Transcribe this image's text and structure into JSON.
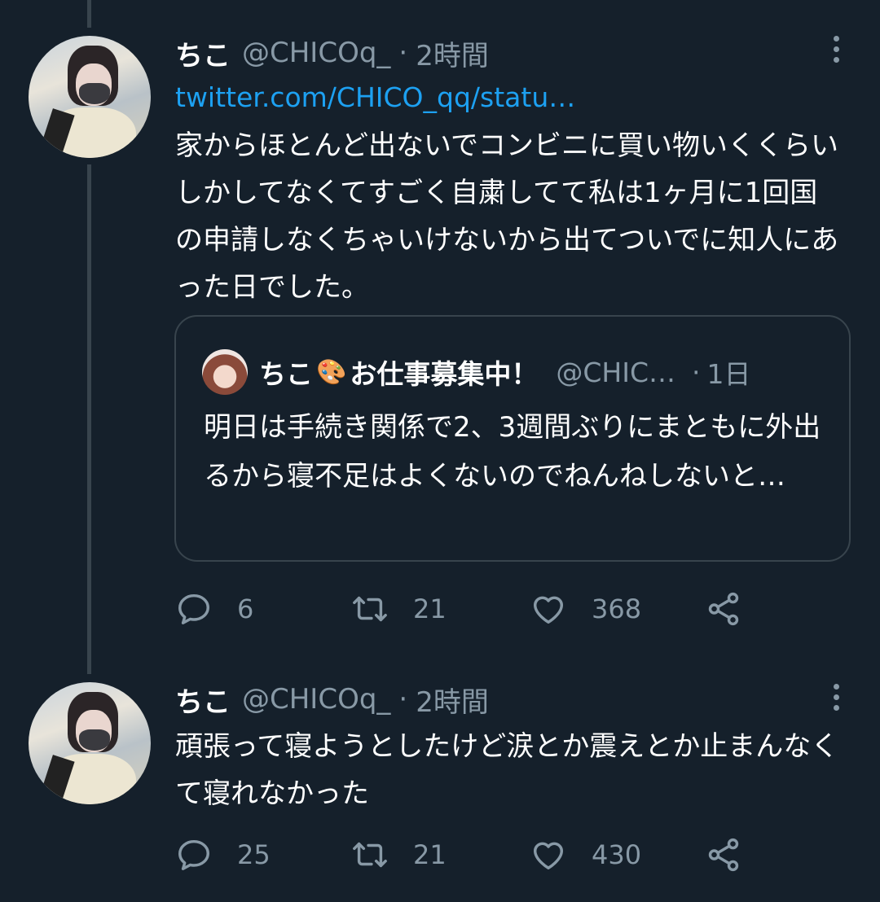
{
  "thread": [
    {
      "author": {
        "name": "ちこ",
        "handle": "@CHICOq_",
        "time": "2時間",
        "separator": "·"
      },
      "link": "twitter.com/CHICO_qq/statu…",
      "text": "家からほとんど出ないでコンビニに買い物いくくらいしかしてなくてすごく自粛してて私は1ヶ月に1回国の申請しなくちゃいけないから出てついでに知人にあった日でした。",
      "quote": {
        "name": "ちこ",
        "name_suffix": "お仕事募集中！",
        "handle": "@CHIC…",
        "separator": "·",
        "time": "1日",
        "text": "明日は手続き関係で2、3週間ぶりにまともに外出るから寝不足はよくないのでねんねしないと…"
      },
      "counts": {
        "replies": "6",
        "retweets": "21",
        "likes": "368"
      }
    },
    {
      "author": {
        "name": "ちこ",
        "handle": "@CHICOq_",
        "time": "2時間",
        "separator": "·"
      },
      "text": "頑張って寝ようとしたけど涙とか震えとか止まんなくて寝れなかった",
      "counts": {
        "replies": "25",
        "retweets": "21",
        "likes": "430"
      }
    }
  ],
  "icons": {
    "reply": "reply-icon",
    "retweet": "retweet-icon",
    "like": "heart-icon",
    "share": "share-icon",
    "more": "more-vertical-icon",
    "palette": "palette-icon"
  },
  "colors": {
    "background": "#15202b",
    "link": "#1da1f2",
    "muted": "#8899a6",
    "border": "#38444d"
  }
}
